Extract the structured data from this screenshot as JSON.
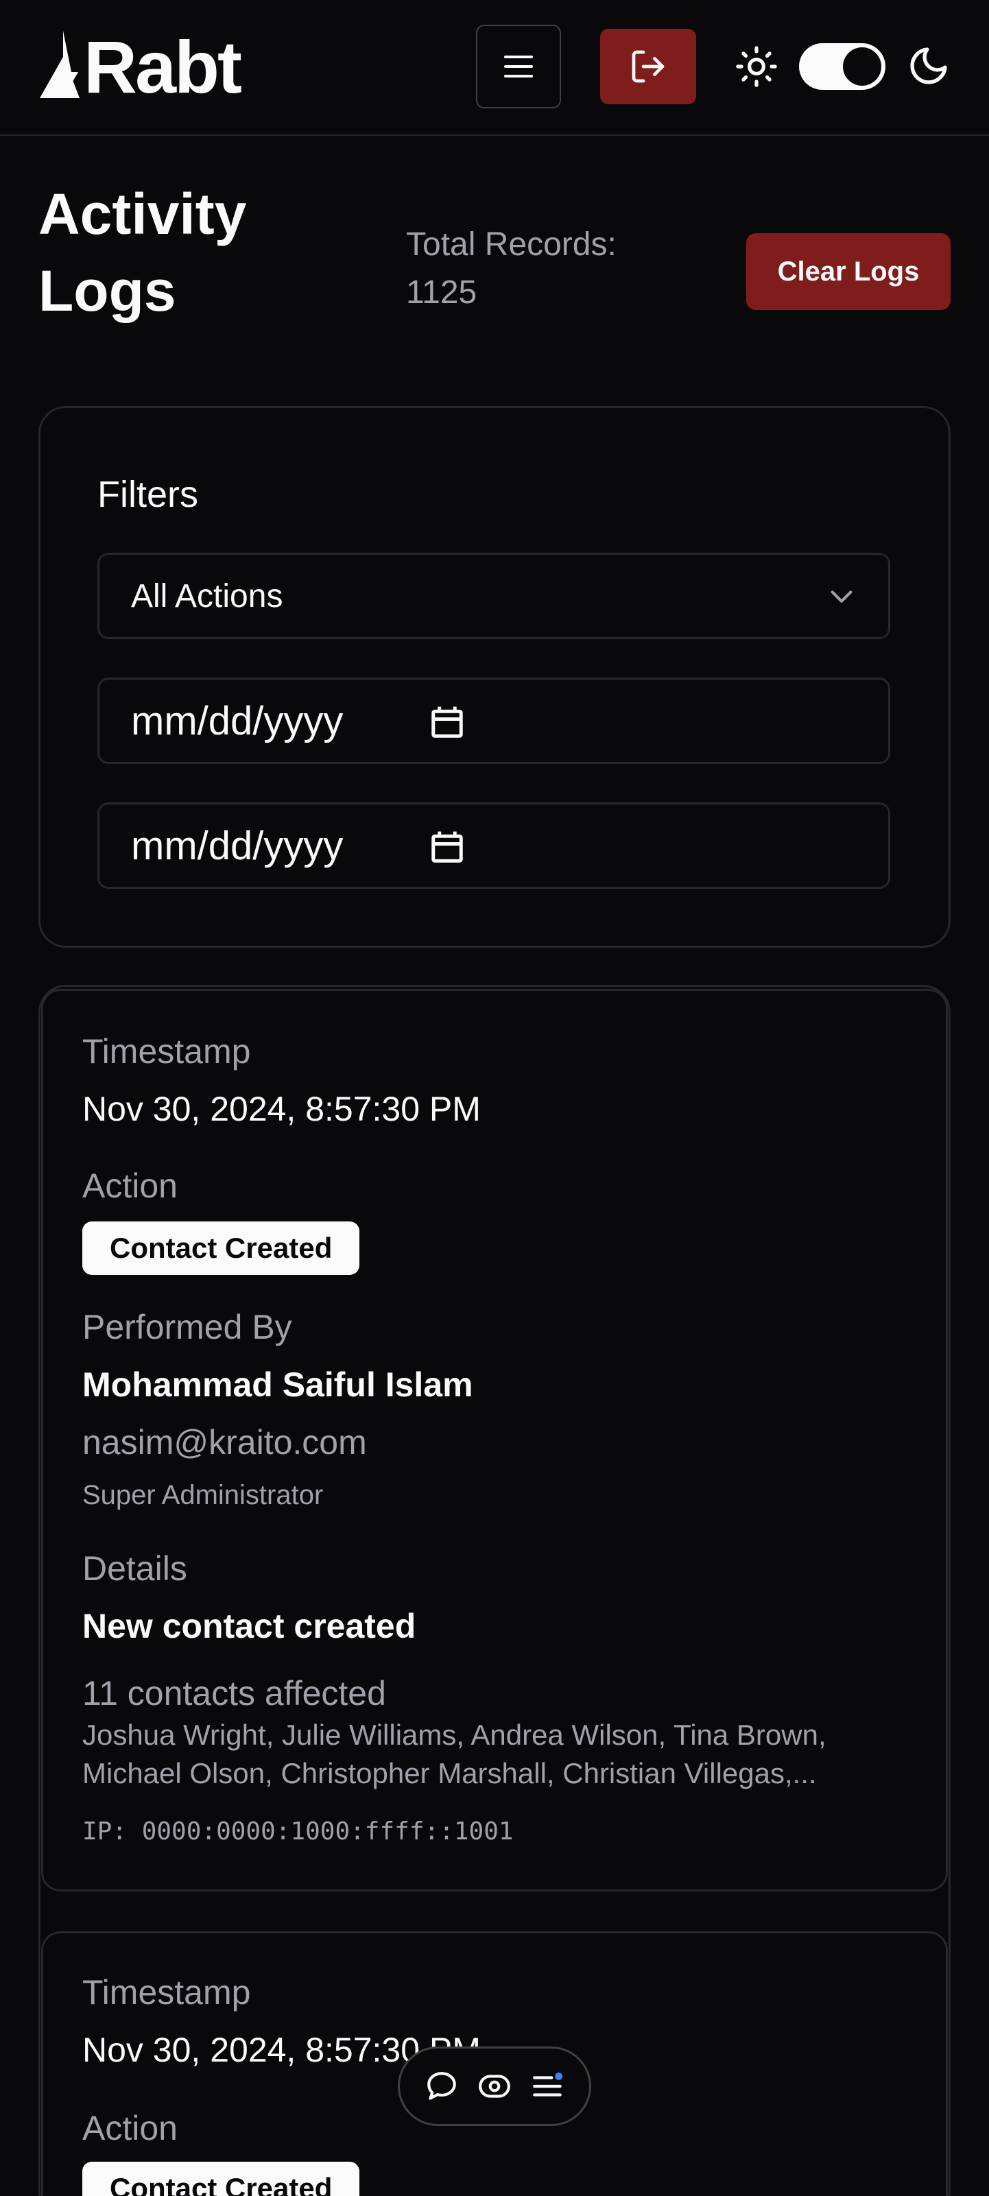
{
  "header": {
    "brand": "Rabt",
    "menu_icon": "hamburger-menu-icon",
    "logout_icon": "logout-icon",
    "theme_light_icon": "sun-icon",
    "theme_dark_icon": "moon-icon",
    "theme_toggle_state": "dark"
  },
  "page": {
    "title": "Activity Logs",
    "total_label": "Total Records:",
    "total_value": "1125",
    "clear_label": "Clear Logs"
  },
  "filters": {
    "title": "Filters",
    "action_select": "All Actions",
    "date_from_placeholder": "mm/dd/yyyy",
    "date_to_placeholder": "mm/dd/yyyy"
  },
  "logs": [
    {
      "timestamp_label": "Timestamp",
      "timestamp": "Nov 30, 2024, 8:57:30 PM",
      "action_label": "Action",
      "action": "Contact Created",
      "performed_label": "Performed By",
      "user_name": "Mohammad Saiful Islam",
      "user_email": "nasim@kraito.com",
      "user_role": "Super Administrator",
      "details_label": "Details",
      "details": "New contact created",
      "affected": "11 contacts affected",
      "affected_names_line1": "Joshua Wright, Julie Williams, Andrea Wilson, Tina Brown,",
      "affected_names_line2": "Michael Olson, Christopher Marshall, Christian Villegas,...",
      "ip": "IP: 0000:0000:1000:ffff::1001"
    },
    {
      "timestamp_label": "Timestamp",
      "timestamp": "Nov 30, 2024, 8:57:30 PM",
      "action_label": "Action",
      "action": "Contact Created"
    }
  ],
  "floating_toolbar": {
    "icons": [
      "chat-icon",
      "eye-icon",
      "list-menu-icon"
    ],
    "notification_color": "#3b82f6"
  },
  "colors": {
    "background": "#09090b",
    "accent_red": "#7f1d1d",
    "border": "#27272a",
    "muted_text": "#a1a1aa"
  }
}
